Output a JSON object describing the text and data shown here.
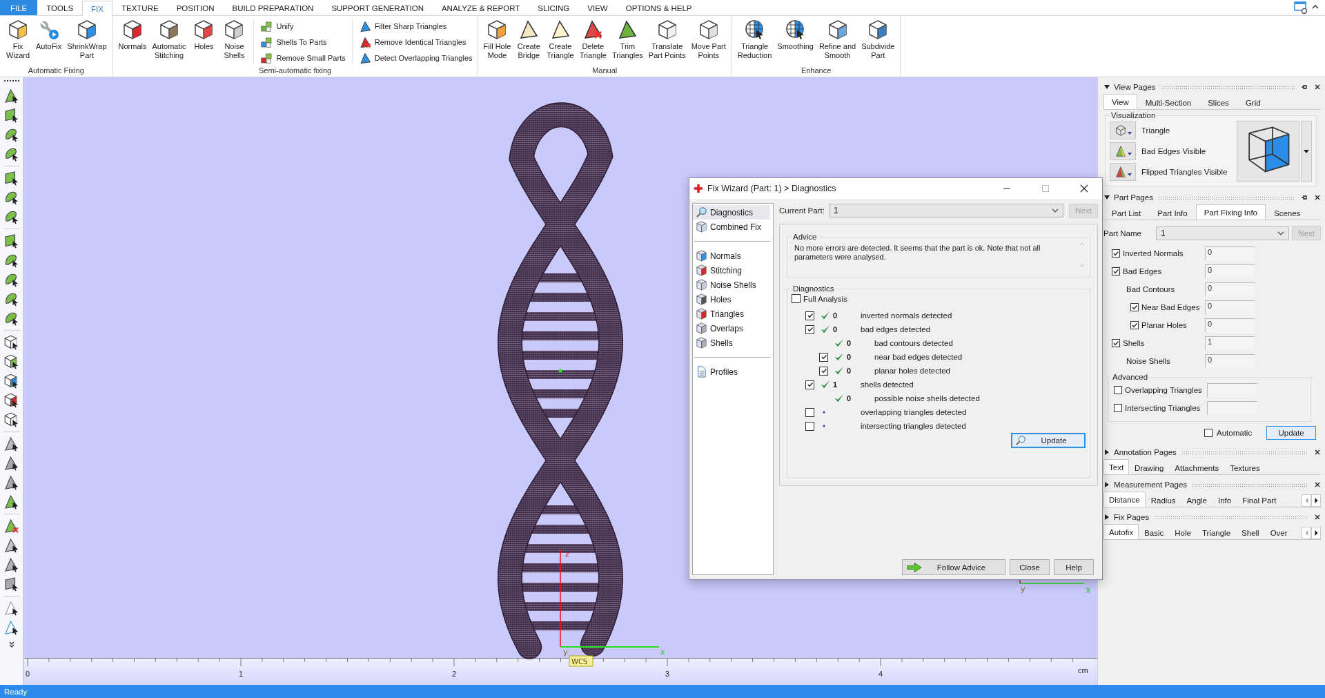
{
  "menu_tabs": [
    {
      "label": "FILE",
      "kind": "file",
      "selected": false
    },
    {
      "label": "TOOLS",
      "kind": "tab",
      "selected": false
    },
    {
      "label": "FIX",
      "kind": "tab",
      "selected": true
    },
    {
      "label": "TEXTURE",
      "kind": "tab",
      "selected": false
    },
    {
      "label": "POSITION",
      "kind": "tab",
      "selected": false
    },
    {
      "label": "BUILD PREPARATION",
      "kind": "tab",
      "selected": false
    },
    {
      "label": "SUPPORT GENERATION",
      "kind": "tab",
      "selected": false
    },
    {
      "label": "ANALYZE & REPORT",
      "kind": "tab",
      "selected": false
    },
    {
      "label": "SLICING",
      "kind": "tab",
      "selected": false
    },
    {
      "label": "VIEW",
      "kind": "tab",
      "selected": false
    },
    {
      "label": "OPTIONS & HELP",
      "kind": "tab",
      "selected": false
    }
  ],
  "ribbon": {
    "groups": [
      {
        "label": "Automatic Fixing",
        "sections": [
          {
            "buttons": [
              {
                "kind": "large",
                "lines": [
                  "Fix",
                  "Wizard"
                ]
              },
              {
                "kind": "large",
                "lines": [
                  "AutoFix"
                ]
              },
              {
                "kind": "large",
                "lines": [
                  "ShrinkWrap",
                  "Part"
                ]
              }
            ]
          }
        ]
      },
      {
        "label": "Semi-automatic fixing",
        "sections": [
          {
            "buttons": [
              {
                "kind": "large",
                "lines": [
                  "Normals"
                ]
              },
              {
                "kind": "large",
                "lines": [
                  "Automatic",
                  "Stitching"
                ]
              },
              {
                "kind": "large",
                "lines": [
                  "Holes"
                ]
              },
              {
                "kind": "large",
                "lines": [
                  "Noise",
                  "Shells"
                ]
              }
            ]
          },
          {
            "buttons": [
              {
                "kind": "small",
                "lines": [
                  "Unify"
                ]
              },
              {
                "kind": "small",
                "lines": [
                  "Shells To Parts"
                ]
              },
              {
                "kind": "small",
                "lines": [
                  "Remove Small Parts"
                ]
              }
            ]
          },
          {
            "buttons": [
              {
                "kind": "small",
                "lines": [
                  "Filter Sharp Triangles"
                ]
              },
              {
                "kind": "small",
                "lines": [
                  "Remove Identical Triangles"
                ]
              },
              {
                "kind": "small",
                "lines": [
                  "Detect Overlapping Triangles"
                ]
              }
            ]
          }
        ]
      },
      {
        "label": "Manual",
        "sections": [
          {
            "buttons": [
              {
                "kind": "large",
                "lines": [
                  "Fill Hole",
                  "Mode"
                ]
              },
              {
                "kind": "large",
                "lines": [
                  "Create",
                  "Bridge"
                ]
              },
              {
                "kind": "large",
                "lines": [
                  "Create",
                  "Triangle"
                ]
              },
              {
                "kind": "large",
                "lines": [
                  "Delete",
                  "Triangle"
                ]
              },
              {
                "kind": "large",
                "lines": [
                  "Trim",
                  "Triangles"
                ]
              },
              {
                "kind": "large",
                "lines": [
                  "Translate",
                  "Part Points"
                ]
              },
              {
                "kind": "large",
                "lines": [
                  "Move Part",
                  "Points"
                ]
              }
            ]
          }
        ]
      },
      {
        "label": "Enhance",
        "sections": [
          {
            "buttons": [
              {
                "kind": "large",
                "lines": [
                  "Triangle",
                  "Reduction"
                ]
              },
              {
                "kind": "large",
                "lines": [
                  "Smoothing"
                ]
              },
              {
                "kind": "large",
                "lines": [
                  "Refine and",
                  "Smooth"
                ]
              },
              {
                "kind": "large",
                "lines": [
                  "Subdivide",
                  "Part"
                ]
              }
            ]
          }
        ]
      }
    ]
  },
  "viewport": {
    "model_axes": {
      "z": "z",
      "x": "x",
      "y": "y",
      "origin": "WCS"
    },
    "view_triad": {
      "y": "y",
      "x": "X"
    },
    "ruler": {
      "ticks": [
        "0",
        "1",
        "2",
        "3",
        "4"
      ],
      "unit": "cm"
    }
  },
  "dialog": {
    "title": "Fix Wizard (Part: 1) > Diagnostics",
    "nav": [
      {
        "items": [
          {
            "label": "Diagnostics",
            "selected": true
          },
          {
            "label": "Combined Fix",
            "selected": false
          }
        ]
      },
      {
        "items": [
          {
            "label": "Normals",
            "selected": false
          },
          {
            "label": "Stitching",
            "selected": false
          },
          {
            "label": "Noise Shells",
            "selected": false
          },
          {
            "label": "Holes",
            "selected": false
          },
          {
            "label": "Triangles",
            "selected": false
          },
          {
            "label": "Overlaps",
            "selected": false
          },
          {
            "label": "Shells",
            "selected": false
          }
        ]
      },
      {
        "items": [
          {
            "label": "Profiles",
            "selected": false
          }
        ]
      }
    ],
    "current_part": {
      "label": "Current Part:",
      "value": "1"
    },
    "next_button": {
      "label": "Next",
      "disabled": true
    },
    "advice": {
      "label": "Advice",
      "text": "No more errors are detected. It seems that the part is ok. Note that not all parameters were analysed."
    },
    "diagnostics": {
      "label": "Diagnostics",
      "full_analysis": {
        "label": "Full Analysis",
        "checked": false
      },
      "rows": [
        {
          "kind": "checkbox",
          "checked": true,
          "passed": true,
          "count": "0",
          "label": "inverted normals detected"
        },
        {
          "kind": "checkbox",
          "checked": true,
          "passed": true,
          "count": "0",
          "label": "bad edges detected",
          "children": [
            {
              "kind": "plain",
              "passed": true,
              "count": "0",
              "label": "bad contours detected"
            },
            {
              "kind": "checkbox",
              "checked": true,
              "passed": true,
              "count": "0",
              "label": "near bad edges detected"
            },
            {
              "kind": "checkbox",
              "checked": true,
              "passed": true,
              "count": "0",
              "label": "planar holes detected"
            }
          ]
        },
        {
          "kind": "checkbox",
          "checked": true,
          "passed": true,
          "count": "1",
          "label": "shells detected",
          "children": [
            {
              "kind": "plain",
              "passed": true,
              "count": "0",
              "label": "possible noise shells detected"
            }
          ]
        },
        {
          "kind": "checkbox",
          "checked": false,
          "passed": false,
          "label": "overlapping triangles detected"
        },
        {
          "kind": "checkbox",
          "checked": false,
          "passed": false,
          "label": "intersecting triangles detected"
        }
      ],
      "update_button": "Update"
    },
    "buttons": [
      {
        "label": "Follow Advice",
        "kind": "advice"
      },
      {
        "label": "Close",
        "kind": "plain"
      },
      {
        "label": "Help",
        "kind": "plain"
      }
    ]
  },
  "view_pages": {
    "title": "View Pages",
    "expanded": true,
    "tabs": [
      {
        "label": "View",
        "selected": true
      },
      {
        "label": "Multi-Section",
        "selected": false
      },
      {
        "label": "Slices",
        "selected": false
      },
      {
        "label": "Grid",
        "selected": false
      }
    ],
    "visualization": {
      "label": "Visualization",
      "options": [
        {
          "label": "Triangle"
        },
        {
          "label": "Bad Edges Visible"
        },
        {
          "label": "Flipped Triangles Visible"
        }
      ]
    }
  },
  "part_pages": {
    "title": "Part Pages",
    "expanded": true,
    "tabs": [
      {
        "label": "Part List",
        "selected": false
      },
      {
        "label": "Part Info",
        "selected": false
      },
      {
        "label": "Part Fixing Info",
        "selected": true
      },
      {
        "label": "Scenes",
        "selected": false
      }
    ],
    "part_name": {
      "label": "Part Name",
      "value": "1"
    },
    "next_button": {
      "label": "Next",
      "disabled": true
    },
    "rows": [
      {
        "kind": "checkbox",
        "label": "Inverted Normals",
        "checked": true,
        "value": "0"
      },
      {
        "kind": "checkbox",
        "label": "Bad Edges",
        "checked": true,
        "value": "0",
        "children": [
          {
            "kind": "plain",
            "label": "Bad Contours",
            "value": "0"
          },
          {
            "kind": "checkbox",
            "label": "Near Bad Edges",
            "checked": true,
            "value": "0"
          },
          {
            "kind": "checkbox",
            "label": "Planar Holes",
            "checked": true,
            "value": "0"
          }
        ]
      },
      {
        "kind": "checkbox",
        "label": "Shells",
        "checked": true,
        "value": "1",
        "children": [
          {
            "kind": "plain",
            "label": "Noise Shells",
            "value": "0"
          }
        ]
      }
    ],
    "advanced": {
      "label": "Advanced",
      "rows": [
        {
          "kind": "checkbox",
          "label": "Overlapping Triangles",
          "checked": false
        },
        {
          "kind": "checkbox",
          "label": "Intersecting Triangles",
          "checked": false
        }
      ]
    },
    "automatic": {
      "label": "Automatic",
      "checked": false
    },
    "update_button": "Update"
  },
  "collapsed_pages": [
    {
      "title": "Annotation Pages",
      "expanded": false,
      "tabs": [
        {
          "label": "Text",
          "selected": true
        },
        {
          "label": "Drawing",
          "selected": false
        },
        {
          "label": "Attachments",
          "selected": false
        },
        {
          "label": "Textures",
          "selected": false
        }
      ]
    },
    {
      "title": "Measurement Pages",
      "expanded": false,
      "scroll_arrows": true,
      "tabs": [
        {
          "label": "Distance",
          "selected": true
        },
        {
          "label": "Radius",
          "selected": false
        },
        {
          "label": "Angle",
          "selected": false
        },
        {
          "label": "Info",
          "selected": false
        },
        {
          "label": "Final Part",
          "selected": false
        }
      ]
    },
    {
      "title": "Fix Pages",
      "expanded": false,
      "scroll_arrows": true,
      "tabs": [
        {
          "label": "Autofix",
          "selected": true
        },
        {
          "label": "Basic",
          "selected": false
        },
        {
          "label": "Hole",
          "selected": false
        },
        {
          "label": "Triangle",
          "selected": false
        },
        {
          "label": "Shell",
          "selected": false
        },
        {
          "label": "Over",
          "selected": false
        }
      ]
    }
  ],
  "status_bar": "Ready"
}
